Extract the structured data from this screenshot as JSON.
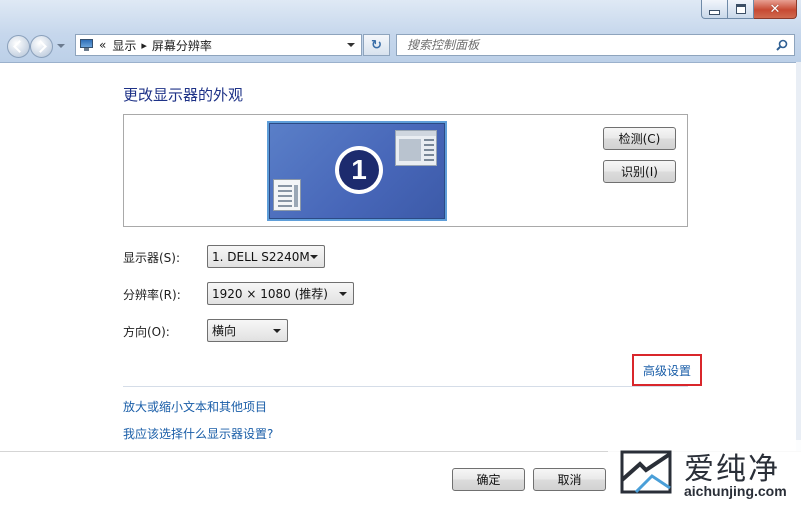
{
  "colors": {
    "accent_link": "#1a5ea8",
    "title_blue": "#1e3287",
    "highlight_box": "#d9262b",
    "monitor_fill": "#4766b8"
  },
  "window": {
    "caption_buttons": {
      "minimize_icon": "minimize-icon",
      "maximize_icon": "maximize-icon",
      "close_icon": "close-icon",
      "close_glyph": "✕"
    }
  },
  "navigation": {
    "back_icon": "back-arrow-icon",
    "forward_icon": "forward-arrow-icon",
    "breadcrumb": {
      "overflow": "«",
      "items": [
        "显示",
        "屏幕分辨率"
      ],
      "separator": "▸"
    },
    "refresh_glyph": "↻",
    "search": {
      "placeholder": "搜索控制面板"
    }
  },
  "main": {
    "title": "更改显示器的外观",
    "preview": {
      "monitor_number": "1"
    },
    "buttons": {
      "detect": "检测(C)",
      "identify": "识别(I)"
    },
    "fields": {
      "display": {
        "label": "显示器(S):",
        "value": "1. DELL S2240M"
      },
      "resolution": {
        "label": "分辨率(R):",
        "value": "1920 × 1080 (推荐)"
      },
      "orientation": {
        "label": "方向(O):",
        "value": "横向"
      }
    },
    "advanced_link": "高级设置",
    "links": {
      "enlarge_text": "放大或缩小文本和其他项目",
      "which_settings": "我应该选择什么显示器设置?"
    }
  },
  "footer": {
    "ok": "确定",
    "cancel": "取消"
  },
  "watermark": {
    "name": "爱纯净",
    "url": "aichunjing.com"
  }
}
